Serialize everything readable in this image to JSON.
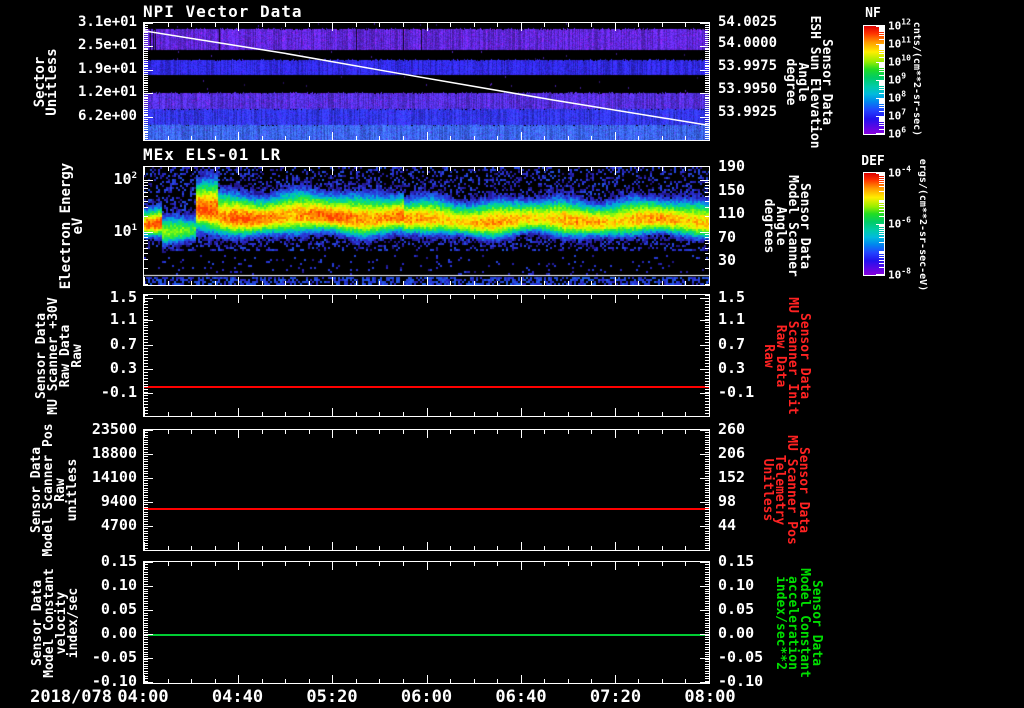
{
  "figure_kind": "multi-panel time-series plot",
  "date_label": "2018/078",
  "x_axis": {
    "tick_labels": [
      "04:00",
      "04:40",
      "05:20",
      "06:00",
      "06:40",
      "07:20",
      "08:00"
    ],
    "minors_per_interval": 3
  },
  "colors": {
    "background": "#000000",
    "axis": "#ffffff",
    "red_series": "#ff0000",
    "red_label": "#ff2222",
    "green_series": "#00cc33",
    "green_label": "#00dd00"
  },
  "chart_data": [
    {
      "type": "heatmap",
      "id": "npi",
      "title": "NPI Vector Data",
      "xlim": [
        "04:00",
        "08:00"
      ],
      "left_axis": {
        "label_lines": [
          "Sector",
          "Unitless"
        ],
        "tick_labels": [
          "3.1e+01",
          "2.5e+01",
          "1.9e+01",
          "1.2e+01",
          "6.2e+00"
        ],
        "tick_values": [
          31,
          25,
          19,
          12,
          6.2
        ],
        "tick_fracs": [
          0.0,
          0.2,
          0.4,
          0.6,
          0.8
        ],
        "minor_count": 62
      },
      "right_axis": {
        "label_lines": [
          "Sensor Data",
          "ESH Sun Elevation",
          "Angle",
          "degree"
        ],
        "label_color": "#ffffff",
        "tick_labels": [
          "54.0025",
          "54.0000",
          "53.9975",
          "53.9950",
          "53.9925"
        ],
        "tick_values": [
          54.0025,
          54.0,
          53.9975,
          53.995,
          53.9925
        ],
        "tick_fracs": [
          0.0,
          0.176,
          0.378,
          0.571,
          0.765
        ],
        "minor_count": 48
      },
      "overlay_line": {
        "name": "esh-sun-elevation-trace",
        "color": "#ffffff",
        "points_frac": [
          [
            0,
            0.067
          ],
          [
            0.25,
            0.26
          ],
          [
            0.45,
            0.43
          ],
          [
            0.72,
            0.655
          ],
          [
            1,
            0.875
          ]
        ],
        "meaning": "ESH Sun Elevation Angle decreasing from ~54.0018 to ~53.9918 degrees"
      },
      "bands": [
        {
          "y0": 0.05,
          "y1": 0.227,
          "color": "#5c28da",
          "streaks": true
        },
        {
          "y0": 0.319,
          "y1": 0.445,
          "color": "#2f2cea",
          "streaks": false
        },
        {
          "y0": 0.597,
          "y1": 0.739,
          "color": "#5230e0",
          "streaks": false
        },
        {
          "y0": 0.739,
          "y1": 0.874,
          "color": "#3138f0",
          "streaks": false
        },
        {
          "y0": 0.874,
          "y1": 1.0,
          "color": "#3a68f5",
          "streaks": false
        }
      ],
      "colorbar": {
        "name": "NF",
        "units": "cnts/(cm**2-sr-sec)",
        "tick_labels": [
          "10^12",
          "10^11",
          "10^10",
          "10^9",
          "10^8",
          "10^7",
          "10^6"
        ],
        "log_decades": [
          12,
          6
        ]
      }
    },
    {
      "type": "heatmap",
      "id": "els",
      "title": "MEx ELS-01 LR",
      "xlim": [
        "04:00",
        "08:00"
      ],
      "left_axis": {
        "label_lines": [
          "Electron Energy",
          "eV"
        ],
        "tick_labels": [
          "10^2",
          "10^1"
        ],
        "tick_values": [
          100,
          10
        ],
        "tick_fracs": [
          0.11,
          0.55
        ],
        "scale": "log",
        "log_range": [
          178,
          0.95
        ]
      },
      "right_axis": {
        "label_lines": [
          "Sensor Data",
          "Model Scanner",
          "Angle",
          "degrees"
        ],
        "label_color": "#ffffff",
        "tick_labels": [
          "190",
          "150",
          "110",
          "70",
          "30"
        ],
        "tick_values": [
          190,
          150,
          110,
          70,
          30
        ],
        "tick_fracs": [
          0.0,
          0.2,
          0.4,
          0.6,
          0.8
        ],
        "minor_count": 40
      },
      "description": "Electron energy spectrogram: bright green-yellow flux band near 15-60 eV persisting 04:00-08:00, orange-yellow enhancements before ~04:55, blue speckle noise above and below, dark band near bottom with sparse counts",
      "texture": {
        "seed": 7,
        "segments": [
          {
            "x1": 0.0,
            "x2": 0.03,
            "amp": 0.95,
            "center": 0.47,
            "width": 0.085
          },
          {
            "x1": 0.03,
            "x2": 0.092,
            "amp": 0.6,
            "center": 0.55,
            "width": 0.095
          },
          {
            "x1": 0.092,
            "x2": 0.128,
            "amp": 1.02,
            "center": 0.37,
            "width": 0.175
          },
          {
            "x1": 0.128,
            "x2": 0.46,
            "amp": 0.93,
            "center": 0.42,
            "width": 0.13
          },
          {
            "x1": 0.46,
            "x2": 1.0,
            "amp": 0.85,
            "center": 0.45,
            "width": 0.115
          }
        ],
        "speckle_above_p": 0.3,
        "speckle_below_p": 0.06,
        "dark_zone": [
          0.74,
          0.91
        ],
        "divider_frac": 0.915,
        "dash_row": 0.93,
        "dash_p": 0.55
      },
      "colorbar": {
        "name": "DEF",
        "units": "ergs/(cm**2-sr-sec-eV)",
        "tick_labels": [
          "10^-4",
          "10^-6",
          "10^-8"
        ],
        "log_decades": [
          -4,
          -8
        ]
      }
    },
    {
      "type": "line",
      "id": "p3",
      "xlim": [
        "04:00",
        "08:00"
      ],
      "left_axis": {
        "label_lines": [
          "Sensor Data",
          "MU Scanner +30V",
          "Raw Data",
          "Raw"
        ],
        "tick_labels": [
          "1.5",
          "1.1",
          "0.7",
          "0.3",
          "-0.1"
        ],
        "tick_values": [
          1.5,
          1.1,
          0.7,
          0.3,
          -0.1
        ],
        "tick_fracs": [
          0.024,
          0.21,
          0.41,
          0.61,
          0.81
        ],
        "minor_count": 41
      },
      "right_axis": {
        "label_lines": [
          "Sensor Data",
          "MU Scanner Init",
          "Raw Data",
          "Raw"
        ],
        "label_color": "#ff2222",
        "tick_labels": [
          "1.5",
          "1.1",
          "0.7",
          "0.3",
          "-0.1"
        ],
        "tick_values": [
          1.5,
          1.1,
          0.7,
          0.3,
          -0.1
        ],
        "tick_fracs": [
          0.024,
          0.21,
          0.41,
          0.61,
          0.81
        ],
        "minor_count": 41
      },
      "series": [
        {
          "name": "mu-scanner-plus30v-raw",
          "color": "#ff0000",
          "value": 0.0,
          "frac": 0.755,
          "shape": "constant"
        }
      ]
    },
    {
      "type": "line",
      "id": "p4",
      "xlim": [
        "04:00",
        "08:00"
      ],
      "left_axis": {
        "label_lines": [
          "Sensor Data",
          "Model Scanner Pos",
          "Raw",
          "unitless"
        ],
        "tick_labels": [
          "23500",
          "18800",
          "14100",
          "9400",
          "4700"
        ],
        "tick_values": [
          23500,
          18800,
          14100,
          9400,
          4700
        ],
        "tick_fracs": [
          0.0,
          0.2,
          0.4,
          0.6,
          0.8
        ],
        "minor_count": 50
      },
      "right_axis": {
        "label_lines": [
          "Sensor Data",
          "MU Scanner Pos",
          "Telemetry",
          "Unitless"
        ],
        "label_color": "#ff2222",
        "tick_labels": [
          "260",
          "206",
          "152",
          "98",
          "44"
        ],
        "tick_values": [
          260,
          206,
          152,
          98,
          44
        ],
        "tick_fracs": [
          0.0,
          0.2,
          0.4,
          0.6,
          0.8
        ],
        "minor_count": 50
      },
      "series": [
        {
          "name": "model-scanner-pos-raw",
          "color": "#ff0000",
          "value": 8300,
          "value_right_scale": 85,
          "frac": 0.648,
          "shape": "constant"
        }
      ]
    },
    {
      "type": "line",
      "id": "p5",
      "xlim": [
        "04:00",
        "08:00"
      ],
      "left_axis": {
        "label_lines": [
          "Sensor Data",
          "Model Constant",
          "velocity",
          "index/sec"
        ],
        "tick_labels": [
          "0.15",
          "0.10",
          "0.05",
          "0.00",
          "-0.05",
          "-0.10"
        ],
        "tick_values": [
          0.15,
          0.1,
          0.05,
          0.0,
          -0.05,
          -0.1
        ],
        "tick_fracs": [
          0.0,
          0.2,
          0.4,
          0.595,
          0.79,
          0.99
        ],
        "minor_count": 50
      },
      "right_axis": {
        "label_lines": [
          "Sensor Data",
          "Model Constant",
          "acceleration",
          "index/sec**2"
        ],
        "label_color": "#00dd00",
        "tick_labels": [
          "0.15",
          "0.10",
          "0.05",
          "0.00",
          "-0.05",
          "-0.10"
        ],
        "tick_values": [
          0.15,
          0.1,
          0.05,
          0.0,
          -0.05,
          -0.1
        ],
        "tick_fracs": [
          0.0,
          0.2,
          0.4,
          0.595,
          0.79,
          0.99
        ],
        "minor_count": 50
      },
      "series": [
        {
          "name": "model-constant-velocity",
          "color": "#00cc33",
          "value": 0.0,
          "frac": 0.595,
          "shape": "constant"
        }
      ]
    }
  ]
}
